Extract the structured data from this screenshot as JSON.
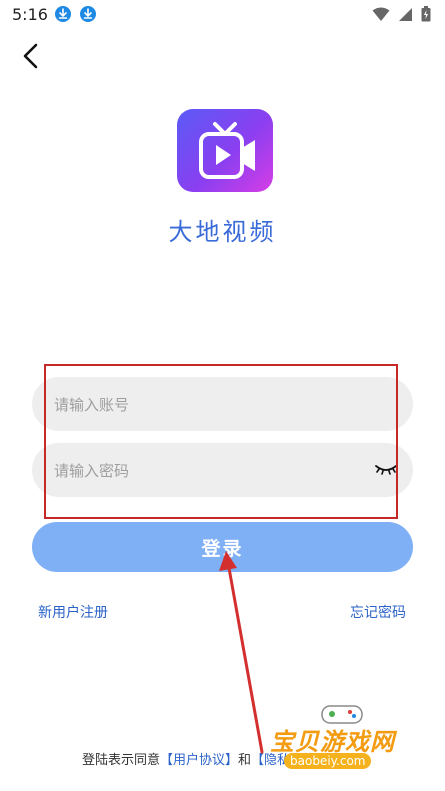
{
  "status_bar": {
    "time": "5:16",
    "left_icons": [
      "download-icon",
      "download-icon"
    ],
    "right_icons": [
      "wifi-icon",
      "signal-icon",
      "battery-icon"
    ]
  },
  "header": {
    "back_icon": "chevron-left-icon"
  },
  "app": {
    "name": "大地视频",
    "logo_icon": "tv-play-icon"
  },
  "form": {
    "account_placeholder": "请输入账号",
    "password_placeholder": "请输入密码",
    "eye_icon": "eye-closed-icon",
    "login_label": "登录"
  },
  "links": {
    "register": "新用户注册",
    "forgot": "忘记密码"
  },
  "agreement": {
    "prefix": "登陆表示同意",
    "user_agreement": "【用户协议】",
    "conjunction": "和",
    "privacy": "【隐私政策】"
  },
  "watermark": {
    "title": "宝贝游戏网",
    "url": "baobeiy.com"
  },
  "colors": {
    "accent": "#3b6bd8",
    "login_button": "#7fb0f6",
    "input_bg": "#eeeeee",
    "highlight": "#c62828"
  }
}
